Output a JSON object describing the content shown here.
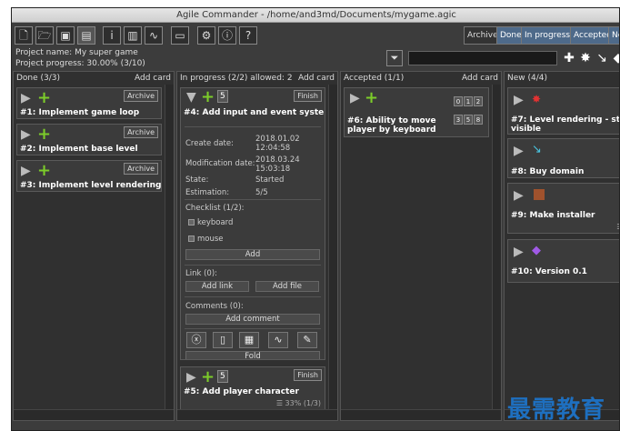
{
  "window": {
    "title": "Agile Commander - /home/and3md/Documents/mygame.agic"
  },
  "toolbar": {
    "icons": [
      "new-file-icon",
      "open-folder-icon",
      "save-icon",
      "save-as-icon",
      "info-icon",
      "bar-chart-icon",
      "activity-icon",
      "hdd-icon",
      "settings-icon",
      "about-icon",
      "help-icon"
    ]
  },
  "filters": [
    {
      "label": "Archive"
    },
    {
      "label": "Done"
    },
    {
      "label": "In progress"
    },
    {
      "label": "Accepted"
    },
    {
      "label": "Ne"
    }
  ],
  "project": {
    "name": "Project name: My super game",
    "progress": "Project progress: 30.00% (3/10)"
  },
  "columns": {
    "done": {
      "title": "Done (3/3)",
      "add": "Add card"
    },
    "inprogress": {
      "title": "In progress (2/2) allowed: 2",
      "add": "Add card"
    },
    "accepted": {
      "title": "Accepted (1/1)",
      "add": "Add card"
    },
    "new": {
      "title": "New (4/4)"
    }
  },
  "done_cards": [
    {
      "title": "#1: Implement game loop",
      "badge": "Archive"
    },
    {
      "title": "#2: Implement base level",
      "badge": "Archive"
    },
    {
      "title": "#3: Implement level rendering",
      "badge": "Archive"
    }
  ],
  "card4": {
    "title": "#4: Add input and event system",
    "badge": "Finish",
    "count": "5",
    "create_label": "Create date:",
    "create_value": "2018.01.02\n12:04:58",
    "mod_label": "Modification date:",
    "mod_value": "2018.03.24\n15:03:18",
    "state_label": "State:",
    "state_value": "Started",
    "est_label": "Estimation:",
    "est_value": "5/5",
    "checklist_label": "Checklist (1/2):",
    "check1": "keyboard",
    "check2": "mouse",
    "add_btn": "Add",
    "link_label": "Link (0):",
    "add_link": "Add link",
    "add_file": "Add file",
    "comments_label": "Comments (0):",
    "add_comment": "Add comment",
    "fold": "Fold"
  },
  "card5": {
    "title": "#5: Add player character",
    "badge": "Finish",
    "count": "5",
    "progress": "33% (1/3)"
  },
  "card6": {
    "title": "#6: Ability to move player by keyboard",
    "numbers": [
      "0",
      "1",
      "2",
      "3",
      "5",
      "8"
    ]
  },
  "new_cards": [
    {
      "title": "#7: Level rendering - stone",
      "title2": "visible"
    },
    {
      "title": "#8: Buy domain"
    },
    {
      "title": "#9: Make installer",
      "progress": "0"
    },
    {
      "title": "#10: Version 0.1"
    }
  ],
  "watermark": "最需教育"
}
